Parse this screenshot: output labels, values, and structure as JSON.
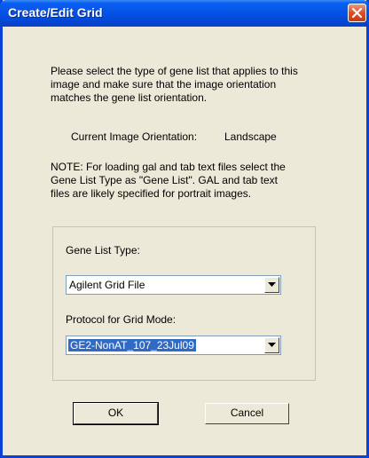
{
  "window": {
    "title": "Create/Edit Grid"
  },
  "instructions": {
    "line1": "Please select the type of gene list that applies to this",
    "line2": "image and make sure that the image orientation",
    "line3": "matches the gene list orientation."
  },
  "orientation": {
    "label": "Current Image Orientation:",
    "value": "Landscape"
  },
  "note": {
    "line1": "NOTE: For loading gal and tab text files select the",
    "line2": "Gene List Type as \"Gene List\". GAL and tab text",
    "line3": "files are likely specified for portrait images."
  },
  "gene_list_type": {
    "label": "Gene List Type:",
    "selected": "Agilent Grid File"
  },
  "protocol": {
    "label": "Protocol for Grid Mode:",
    "selected": "GE2-NonAT_107_23Jul09"
  },
  "buttons": {
    "ok": "OK",
    "cancel": "Cancel"
  }
}
